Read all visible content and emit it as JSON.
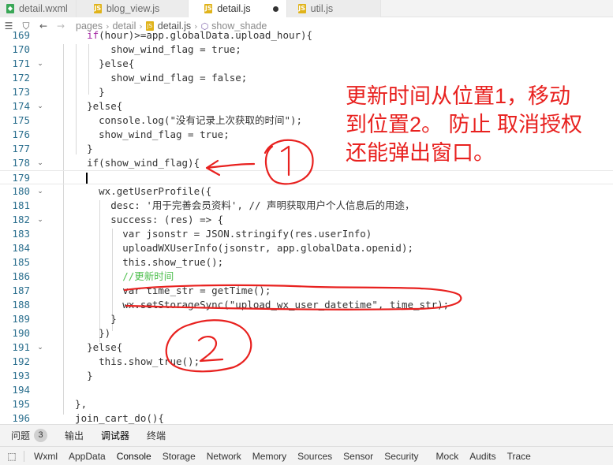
{
  "tabs": [
    {
      "label": "detail.wxml",
      "icon": "wxml-file-icon"
    },
    {
      "label": "blog_view.js",
      "icon": "js-file-icon"
    },
    {
      "label": "detail.js",
      "icon": "js-file-icon",
      "active": true,
      "modified": true
    },
    {
      "label": "util.js",
      "icon": "js-file-icon"
    }
  ],
  "breadcrumb": {
    "parts": [
      "pages",
      "detail",
      "detail.js",
      "show_shade"
    ],
    "icons": [
      "list-icon",
      "bookmark-icon",
      "back-arrow-icon",
      "forward-arrow-icon",
      "js-file-icon",
      "method-cube-icon"
    ]
  },
  "code": {
    "first_line_partial": "    if(hour)>=app.globalData.upload_hour){",
    "lines": [
      {
        "n": "169",
        "text": "      if(hour)>=app.globalData.upload_hour){"
      },
      {
        "n": "170",
        "text": "        show_wind_flag = true;"
      },
      {
        "n": "171",
        "text": "      }else{"
      },
      {
        "n": "172",
        "text": "        show_wind_flag = false;"
      },
      {
        "n": "173",
        "text": "      }"
      },
      {
        "n": "174",
        "text": "    }else{"
      },
      {
        "n": "175",
        "text": "      console.log(\"没有记录上次获取的时间\");"
      },
      {
        "n": "176",
        "text": "      show_wind_flag = true;"
      },
      {
        "n": "177",
        "text": "    }"
      },
      {
        "n": "178",
        "text": "    if(show_wind_flag){"
      },
      {
        "n": "179",
        "text": ""
      },
      {
        "n": "180",
        "text": "      wx.getUserProfile({"
      },
      {
        "n": "181",
        "text": "        desc: '用于完善会员资料', // 声明获取用户个人信息后的用途，"
      },
      {
        "n": "182",
        "text": "        success: (res) => {"
      },
      {
        "n": "183",
        "text": "          var jsonstr = JSON.stringify(res.userInfo)"
      },
      {
        "n": "184",
        "text": "          uploadWXUserInfo(jsonstr, app.globalData.openid);"
      },
      {
        "n": "185",
        "text": "          this.show_true();"
      },
      {
        "n": "186",
        "text": "          //更新时间"
      },
      {
        "n": "187",
        "text": "          var time_str = getTime();"
      },
      {
        "n": "188",
        "text": "          wx.setStorageSync(\"upload_wx_user_datetime\", time_str);"
      },
      {
        "n": "189",
        "text": "        }"
      },
      {
        "n": "190",
        "text": "      })"
      },
      {
        "n": "191",
        "text": "    }else{"
      },
      {
        "n": "192",
        "text": "      this.show_true();"
      },
      {
        "n": "193",
        "text": "    }"
      },
      {
        "n": "194",
        "text": ""
      },
      {
        "n": "195",
        "text": "  },"
      },
      {
        "n": "196",
        "text": "  join_cart_do(){"
      }
    ]
  },
  "annotation": {
    "text": "更新时间从位置1，移动\n到位置2。 防止 取消授权\n还能弹出窗口。",
    "color": "#e8211f"
  },
  "panel_tabs": [
    {
      "label": "问题",
      "badge": "3"
    },
    {
      "label": "输出"
    },
    {
      "label": "调试器",
      "active": true
    },
    {
      "label": "终端"
    }
  ],
  "devtools_tabs": [
    "Wxml",
    "AppData",
    "Console",
    "Storage",
    "Network",
    "Memory",
    "Sources",
    "Sensor",
    "Security",
    "Mock",
    "Audits",
    "Trace"
  ],
  "devtools_active": "Console"
}
